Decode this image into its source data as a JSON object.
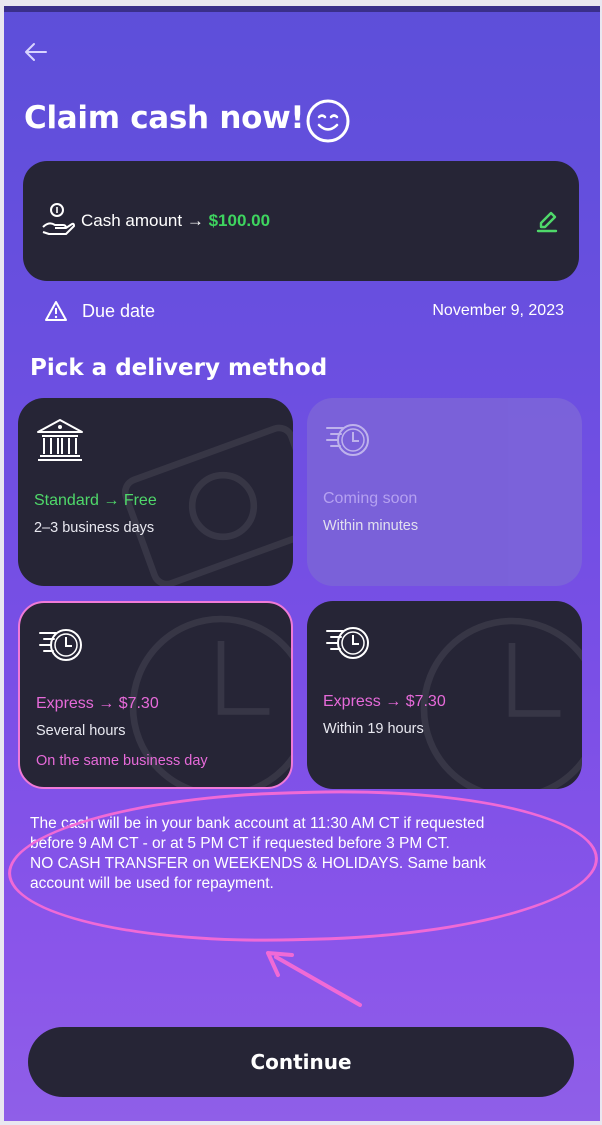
{
  "header": {
    "back_icon": "arrow-left-icon",
    "title": "Claim cash now!",
    "title_icon": "smiley-face-icon"
  },
  "amount_card": {
    "label": "Cash amount",
    "arrow": "→",
    "value": "$100.00",
    "icon": "hand-coin-icon",
    "edit_icon": "pencil-icon"
  },
  "due": {
    "icon": "warning-triangle-icon",
    "label": "Due date",
    "date": "November 9, 2023"
  },
  "delivery": {
    "title": "Pick a delivery method",
    "options": [
      {
        "icon": "bank-icon",
        "head": "Standard → Free",
        "sub": "2–3 business days",
        "note": "",
        "state": "available"
      },
      {
        "icon": "fast-clock-icon",
        "head": "Coming soon",
        "sub": "Within minutes",
        "note": "",
        "state": "disabled"
      },
      {
        "icon": "fast-clock-icon",
        "head": "Express → $7.30",
        "sub": "Several hours",
        "note": "On the same business day",
        "state": "selected"
      },
      {
        "icon": "fast-clock-icon",
        "head": "Express → $7.30",
        "sub": "Within 19 hours",
        "note": "",
        "state": "available"
      }
    ]
  },
  "info": {
    "line1": "The cash will be in your bank account at 11:30 AM CT if requested",
    "line2": "before 9 AM CT - or at 5 PM CT if requested before 3 PM CT.",
    "line3": "NO CASH TRANSFER on WEEKENDS & HOLIDAYS. Same bank",
    "line4": "account will be used for repayment."
  },
  "continue_label": "Continue",
  "colors": {
    "accent_green": "#4fd86a",
    "accent_pink": "#e66ad9",
    "card_dark": "#262536",
    "annotation": "#f06ad6"
  }
}
